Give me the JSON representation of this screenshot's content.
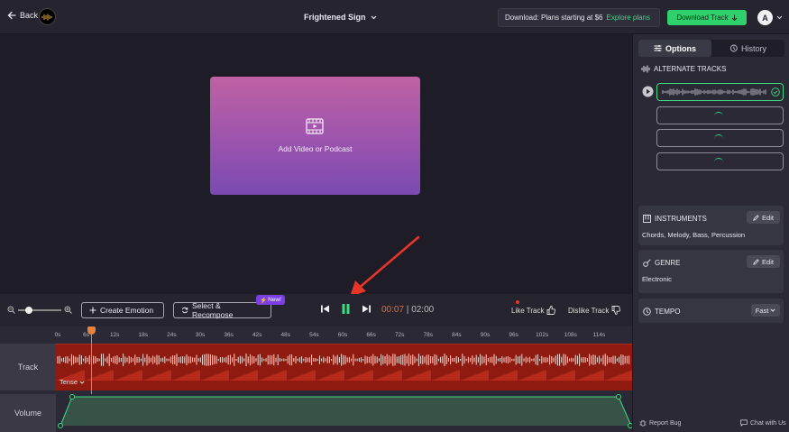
{
  "header": {
    "back_label": "Back",
    "logo_text": "MM",
    "title": "Frightened Sign",
    "download_info": "Download: Plans starting at $6",
    "explore_link": "Explore plans",
    "download_button": "Download Track",
    "avatar_initial": "A"
  },
  "stage": {
    "add_video_label": "Add Video or Podcast"
  },
  "controls": {
    "create_emotion": "Create Emotion",
    "select_recompose": "Select & Recompose",
    "new_badge": "New!",
    "current_time": "00:07",
    "separator": " | ",
    "total_time": "02:00",
    "like_label": "Like Track",
    "dislike_label": "Dislike Track"
  },
  "timeline": {
    "ticks": [
      "0s",
      "6s",
      "12s",
      "18s",
      "24s",
      "30s",
      "36s",
      "42s",
      "48s",
      "54s",
      "60s",
      "66s",
      "72s",
      "78s",
      "84s",
      "90s",
      "96s",
      "102s",
      "108s",
      "114s"
    ],
    "track_label": "Track",
    "volume_label": "Volume",
    "emotion_tag": "Tense",
    "playhead_seconds": 7,
    "duration_seconds": 120
  },
  "panel": {
    "tab_options": "Options",
    "tab_history": "History",
    "alt_tracks_title": "ALTERNATE TRACKS",
    "instruments_title": "INSTRUMENTS",
    "instruments_value": "Chords, Melody, Bass, Percussion",
    "genre_title": "GENRE",
    "genre_value": "Electronic",
    "tempo_title": "TEMPO",
    "tempo_value": "Fast",
    "edit_label": "Edit",
    "report_bug": "Report Bug",
    "chat": "Chat with Us"
  },
  "colors": {
    "accent_green": "#2fd16c",
    "track_red": "#8f1a10",
    "playhead_orange": "#e8813c",
    "badge_purple": "#7b3fe4"
  }
}
